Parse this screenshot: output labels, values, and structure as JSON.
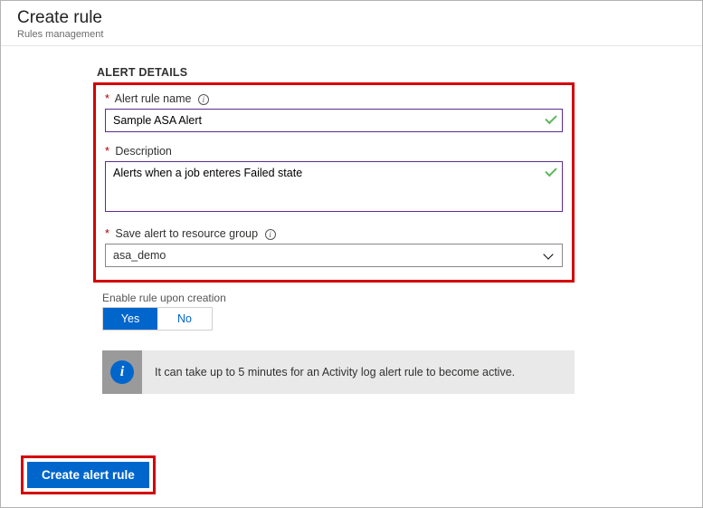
{
  "header": {
    "title": "Create rule",
    "subtitle": "Rules management"
  },
  "section": {
    "title": "ALERT DETAILS"
  },
  "fields": {
    "ruleName": {
      "label": "Alert rule name",
      "value": "Sample ASA Alert"
    },
    "description": {
      "label": "Description",
      "value": "Alerts when a job enteres Failed state"
    },
    "resourceGroup": {
      "label": "Save alert to resource group",
      "value": "asa_demo"
    }
  },
  "enable": {
    "label": "Enable rule upon creation",
    "yes": "Yes",
    "no": "No"
  },
  "note": {
    "text": "It can take up to 5 minutes for an Activity log alert rule to become active."
  },
  "footer": {
    "createBtn": "Create alert rule"
  }
}
